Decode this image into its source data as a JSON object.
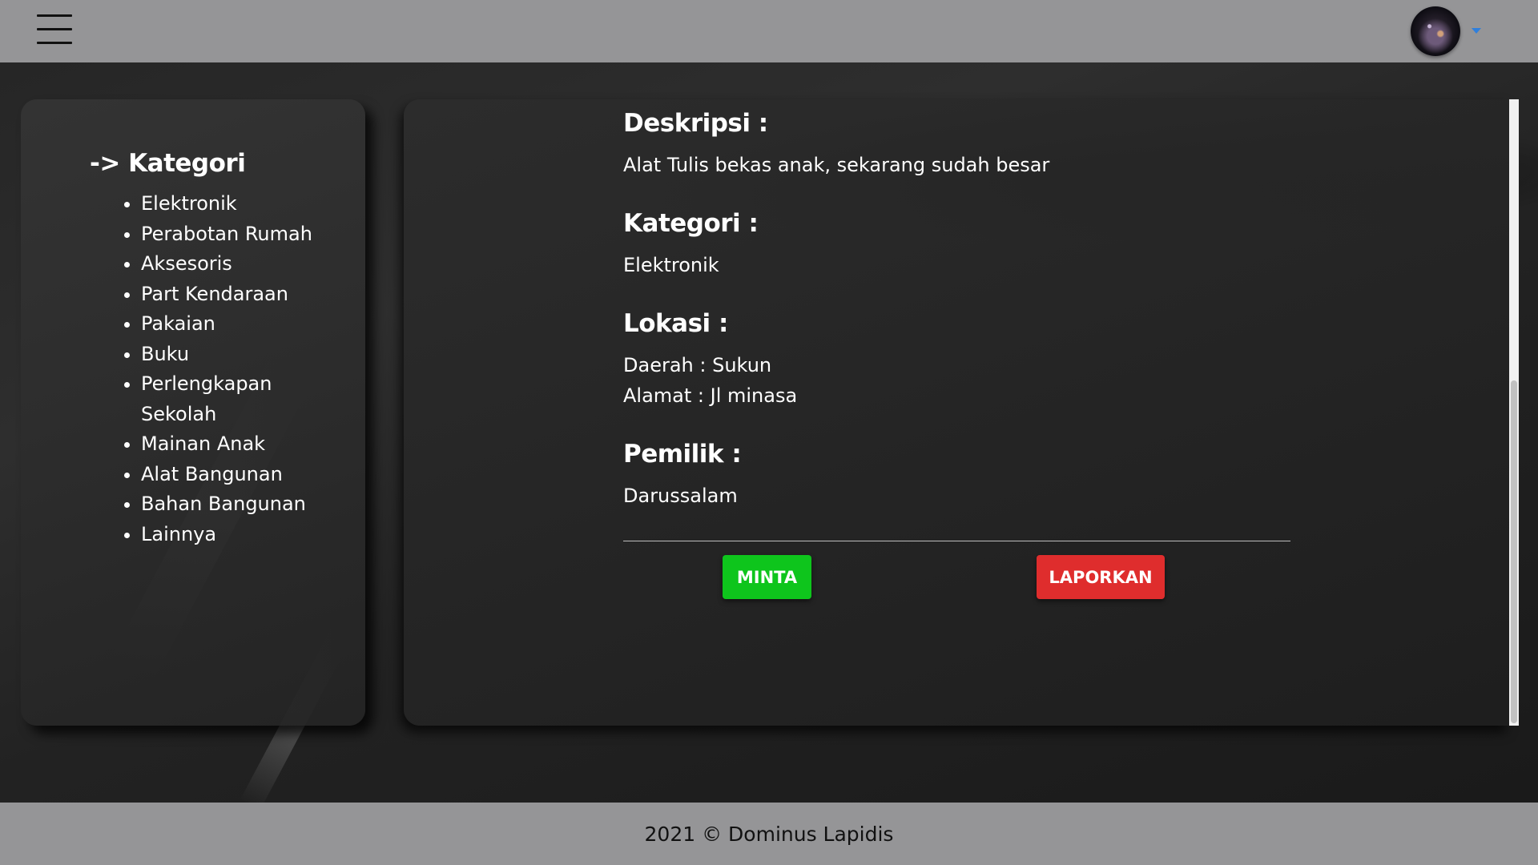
{
  "sidebar": {
    "heading": "-> Kategori",
    "items": [
      "Elektronik",
      "Perabotan Rumah",
      "Aksesoris",
      "Part Kendaraan",
      "Pakaian",
      "Buku",
      "Perlengkapan Sekolah",
      "Mainan Anak",
      "Alat Bangunan",
      "Bahan Bangunan",
      "Lainnya"
    ]
  },
  "detail": {
    "deskripsi_label": "Deskripsi :",
    "deskripsi_value": "Alat Tulis bekas anak, sekarang sudah besar",
    "kategori_label": "Kategori :",
    "kategori_value": "Elektronik",
    "lokasi_label": "Lokasi :",
    "daerah_text": "Daerah : Sukun",
    "alamat_text": "Alamat : Jl minasa",
    "pemilik_label": "Pemilik :",
    "pemilik_value": "Darussalam"
  },
  "actions": {
    "minta_label": "MINTA",
    "laporkan_label": "LAPORKAN"
  },
  "footer": {
    "text": "2021 © Dominus Lapidis"
  },
  "colors": {
    "navbar": "#959597",
    "minta": "#0ec51c",
    "laporkan": "#df2d2d",
    "caret": "#2f7fdc"
  },
  "icons": {
    "menu": "hamburger-menu-icon",
    "dropdown": "caret-down-icon"
  }
}
